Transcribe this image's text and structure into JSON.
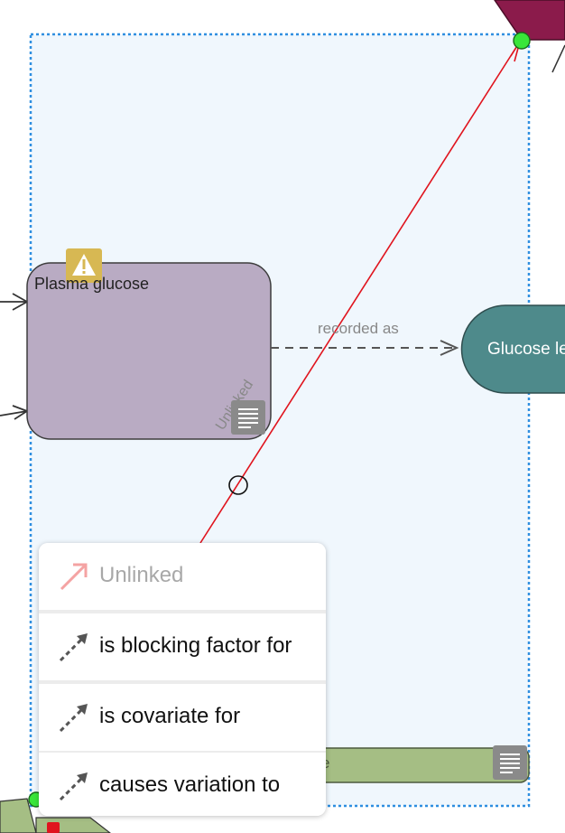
{
  "nodes": {
    "plasma_glucose": {
      "label": "Plasma glucose",
      "warning": true
    },
    "glucose_level": {
      "label": "Glucose le"
    },
    "bottom_bar": {
      "label": "e"
    }
  },
  "edges": {
    "recorded_as": {
      "label": "recorded as"
    },
    "selected_edge": {
      "label": "Unlinked"
    }
  },
  "context_menu": {
    "items": [
      {
        "label": "Unlinked",
        "disabled": true,
        "icon": "red-arrow-icon"
      },
      {
        "label": "is blocking factor for",
        "disabled": false,
        "icon": "dashed-arrow-icon"
      },
      {
        "label": "is covariate for",
        "disabled": false,
        "icon": "dashed-arrow-icon"
      },
      {
        "label": "causes variation to",
        "disabled": false,
        "icon": "dashed-arrow-icon"
      }
    ]
  },
  "colors": {
    "selection_border": "#2f8fe0",
    "selection_fill": "#f0f7fd",
    "plasma_node": "#b9abc3",
    "glucose_node": "#4e8a8b",
    "bar_node": "#a5be84",
    "top_right_node": "#8b1b4b",
    "link_line": "#e0141e",
    "handle": "#39e639"
  }
}
